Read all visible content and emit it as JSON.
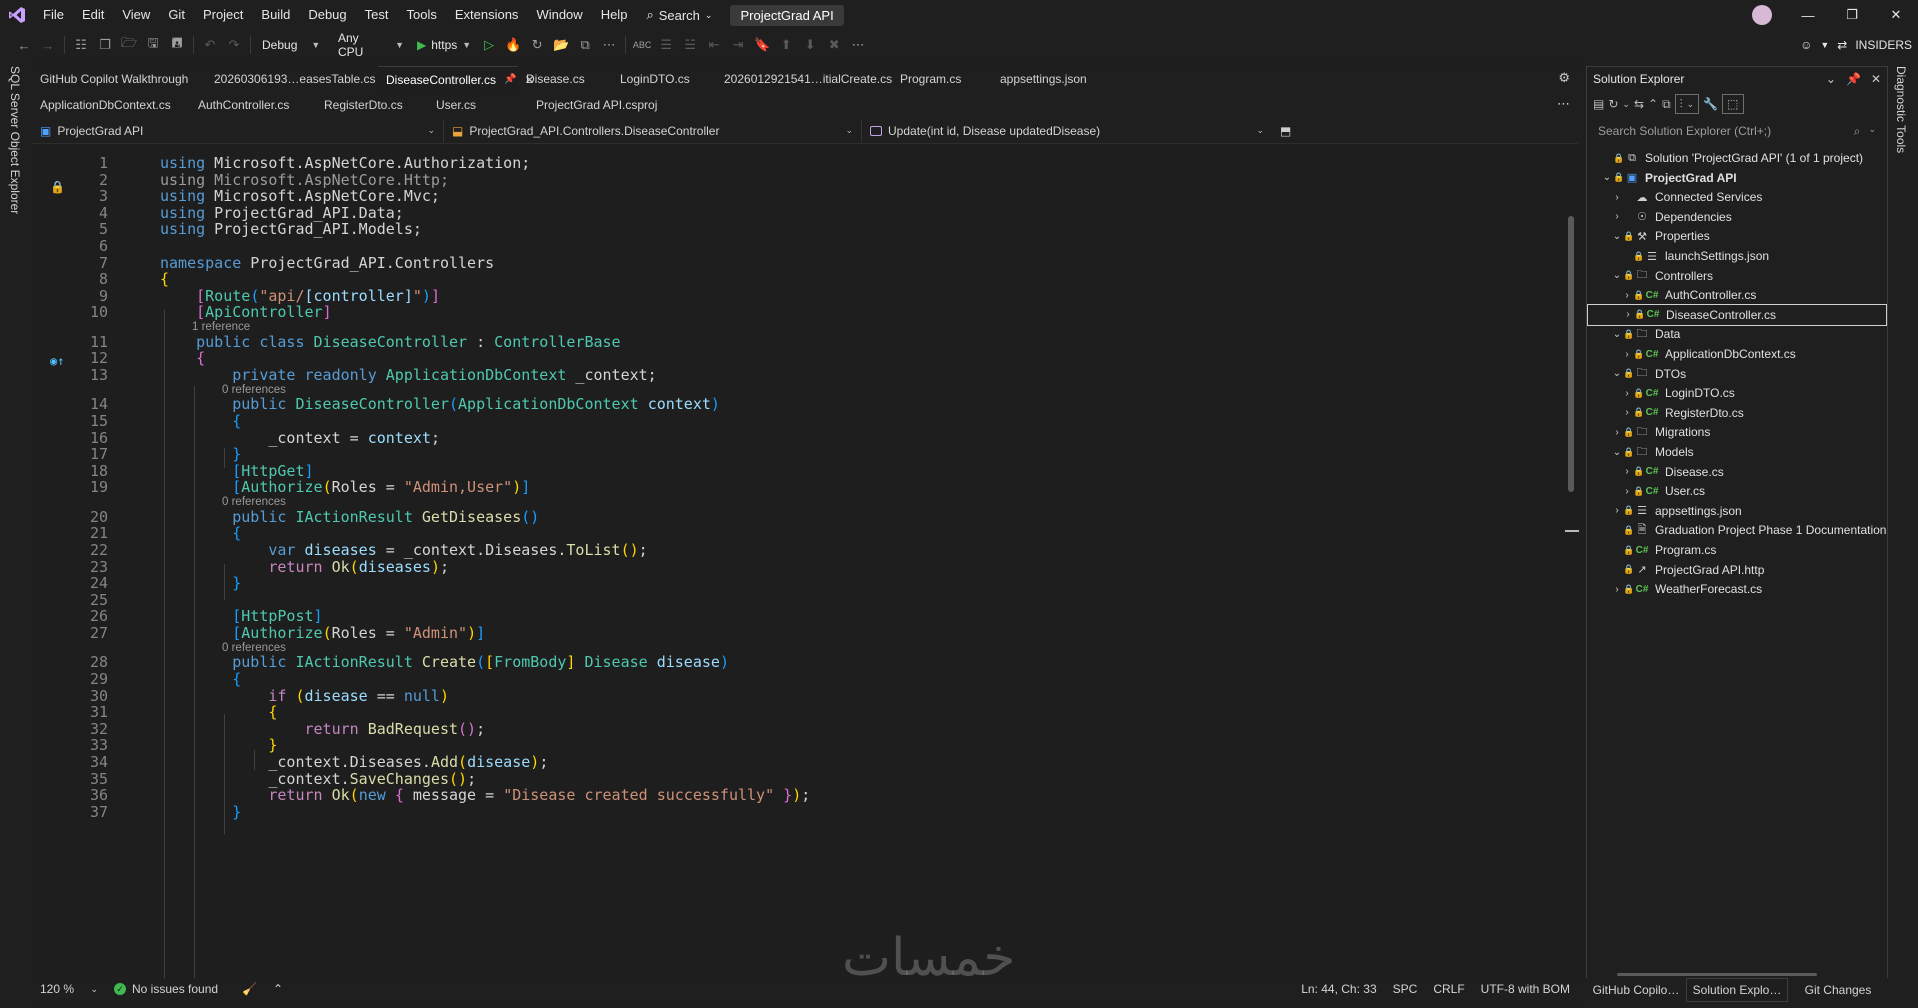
{
  "menu": {
    "items": [
      "File",
      "Edit",
      "View",
      "Git",
      "Project",
      "Build",
      "Debug",
      "Test",
      "Tools",
      "Extensions",
      "Window",
      "Help"
    ],
    "search_label": "Search",
    "project_title": "ProjectGrad API"
  },
  "toolbar": {
    "config": "Debug",
    "platform": "Any CPU",
    "run_target": "https",
    "insiders": "INSIDERS"
  },
  "left_strip": {
    "sql_label": "SQL Server Object Explorer"
  },
  "right_strip": {
    "diag_label": "Diagnostic Tools"
  },
  "tabs_row1": [
    {
      "label": "GitHub Copilot Walkthrough",
      "active": false
    },
    {
      "label": "20260306193…easesTable.cs",
      "active": false
    },
    {
      "label": "DiseaseController.cs",
      "active": true
    },
    {
      "label": "Disease.cs",
      "active": false
    },
    {
      "label": "LoginDTO.cs",
      "active": false
    },
    {
      "label": "2026012921541…itialCreate.cs",
      "active": false
    },
    {
      "label": "Program.cs",
      "active": false
    },
    {
      "label": "appsettings.json",
      "active": false
    }
  ],
  "tabs_row2": [
    {
      "label": "ApplicationDbContext.cs"
    },
    {
      "label": "AuthController.cs"
    },
    {
      "label": "RegisterDto.cs"
    },
    {
      "label": "User.cs"
    },
    {
      "label": "ProjectGrad API.csproj"
    }
  ],
  "navbar": {
    "project": "ProjectGrad API",
    "class": "ProjectGrad_API.Controllers.DiseaseController",
    "member": "Update(int id, Disease updatedDisease)"
  },
  "code_lines": [
    {
      "n": "1",
      "html": "<span class=\"kw\">using</span> Microsoft.AspNetCore.Authorization;"
    },
    {
      "n": "2",
      "html": "<span class=\"dim\">using Microsoft.AspNetCore.Http;</span>"
    },
    {
      "n": "3",
      "html": "<span class=\"kw\">using</span> Microsoft.AspNetCore.Mvc;"
    },
    {
      "n": "4",
      "html": "<span class=\"kw\">using</span> ProjectGrad_API.Data;"
    },
    {
      "n": "5",
      "html": "<span class=\"kw\">using</span> ProjectGrad_API.Models;"
    },
    {
      "n": "6",
      "html": ""
    },
    {
      "n": "7",
      "html": "<span class=\"kw\">namespace</span> ProjectGrad_API.Controllers"
    },
    {
      "n": "8",
      "html": "<span class=\"brk\">{</span>"
    },
    {
      "n": "9",
      "html": "    <span class=\"brk2\">[</span><span class=\"attr\">Route</span><span class=\"brk3\">(</span><span class=\"str\">\"api/</span><span class=\"var\">[controller]</span><span class=\"str\">\"</span><span class=\"brk3\">)</span><span class=\"brk2\">]</span>"
    },
    {
      "n": "10",
      "html": "    <span class=\"brk2\">[</span><span class=\"attr\">ApiController</span><span class=\"brk2\">]</span>"
    },
    {
      "n": "11",
      "html": "    <span class=\"kw\">public class</span> <span class=\"ty\">DiseaseController</span> : <span class=\"ty\">ControllerBase</span>"
    },
    {
      "n": "12",
      "html": "    <span class=\"brk2\">{</span>"
    },
    {
      "n": "13",
      "html": "        <span class=\"kw\">private readonly</span> <span class=\"ty\">ApplicationDbContext</span> _context;"
    },
    {
      "n": "14",
      "html": "        <span class=\"kw\">public</span> <span class=\"ty\">DiseaseController</span><span class=\"brk3\">(</span><span class=\"ty\">ApplicationDbContext</span> <span class=\"var\">context</span><span class=\"brk3\">)</span>"
    },
    {
      "n": "15",
      "html": "        <span class=\"brk3\">{</span>"
    },
    {
      "n": "16",
      "html": "            _context = <span class=\"var\">context</span>;"
    },
    {
      "n": "17",
      "html": "        <span class=\"brk3\">}</span>"
    },
    {
      "n": "18",
      "html": "        <span class=\"brk3\">[</span><span class=\"attr\">HttpGet</span><span class=\"brk3\">]</span>"
    },
    {
      "n": "19",
      "html": "        <span class=\"brk3\">[</span><span class=\"attr\">Authorize</span><span class=\"brk\">(</span>Roles = <span class=\"str\">\"Admin,User\"</span><span class=\"brk\">)</span><span class=\"brk3\">]</span>"
    },
    {
      "n": "20",
      "html": "        <span class=\"kw\">public</span> <span class=\"ty\">IActionResult</span> <span class=\"fn\">GetDiseases</span><span class=\"brk3\">()</span>"
    },
    {
      "n": "21",
      "html": "        <span class=\"brk3\">{</span>"
    },
    {
      "n": "22",
      "html": "            <span class=\"kw\">var</span> <span class=\"var\">diseases</span> = _context.Diseases.<span class=\"fn\">ToList</span><span class=\"brk\">()</span>;"
    },
    {
      "n": "23",
      "html": "            <span class=\"ctl\">return</span> <span class=\"fn\">Ok</span><span class=\"brk\">(</span><span class=\"var\">diseases</span><span class=\"brk\">)</span>;"
    },
    {
      "n": "24",
      "html": "        <span class=\"brk3\">}</span>"
    },
    {
      "n": "25",
      "html": ""
    },
    {
      "n": "26",
      "html": "        <span class=\"brk3\">[</span><span class=\"attr\">HttpPost</span><span class=\"brk3\">]</span>"
    },
    {
      "n": "27",
      "html": "        <span class=\"brk3\">[</span><span class=\"attr\">Authorize</span><span class=\"brk\">(</span>Roles = <span class=\"str\">\"Admin\"</span><span class=\"brk\">)</span><span class=\"brk3\">]</span>"
    },
    {
      "n": "28",
      "html": "        <span class=\"kw\">public</span> <span class=\"ty\">IActionResult</span> <span class=\"fn\">Create</span><span class=\"brk3\">(</span><span class=\"brk\">[</span><span class=\"attr\">FromBody</span><span class=\"brk\">]</span> <span class=\"ty\">Disease</span> <span class=\"var\">disease</span><span class=\"brk3\">)</span>"
    },
    {
      "n": "29",
      "html": "        <span class=\"brk3\">{</span>"
    },
    {
      "n": "30",
      "html": "            <span class=\"ctl\">if</span> <span class=\"brk\">(</span><span class=\"var\">disease</span> == <span class=\"kw\">null</span><span class=\"brk\">)</span>"
    },
    {
      "n": "31",
      "html": "            <span class=\"brk\">{</span>"
    },
    {
      "n": "32",
      "html": "                <span class=\"ctl\">return</span> <span class=\"fn\">BadRequest</span><span class=\"brk2\">()</span>;"
    },
    {
      "n": "33",
      "html": "            <span class=\"brk\">}</span>"
    },
    {
      "n": "34",
      "html": "            _context.Diseases.<span class=\"fn\">Add</span><span class=\"brk\">(</span><span class=\"var\">disease</span><span class=\"brk\">)</span>;"
    },
    {
      "n": "35",
      "html": "            _context.<span class=\"fn\">SaveChanges</span><span class=\"brk\">()</span>;"
    },
    {
      "n": "36",
      "html": "            <span class=\"ctl\">return</span> <span class=\"fn\">Ok</span><span class=\"brk\">(</span><span class=\"kw\">new</span> <span class=\"brk2\">{</span> message = <span class=\"str\">\"Disease created successfully\"</span> <span class=\"brk2\">}</span><span class=\"brk\">)</span>;"
    },
    {
      "n": "37",
      "html": "        <span class=\"brk3\">}</span>"
    }
  ],
  "ref_lens": [
    {
      "after": "10",
      "text": "1 reference"
    },
    {
      "after": "13",
      "text": "0 references"
    },
    {
      "after": "19",
      "text": "0 references"
    },
    {
      "after": "27",
      "text": "0 references"
    }
  ],
  "status": {
    "zoom": "120 %",
    "issues": "No issues found",
    "position": "Ln: 44, Ch: 33",
    "whitespace": "SPC",
    "line_ending": "CRLF",
    "encoding": "UTF-8 with BOM"
  },
  "solution_explorer": {
    "title": "Solution Explorer",
    "search_placeholder": "Search Solution Explorer (Ctrl+;)",
    "tree": [
      {
        "depth": 0,
        "exp": "",
        "lock": true,
        "icon": "sln",
        "label": "Solution 'ProjectGrad API' (1 of 1 project)"
      },
      {
        "depth": 0,
        "exp": "v",
        "lock": true,
        "icon": "proj",
        "label": "ProjectGrad API",
        "bold": true
      },
      {
        "depth": 1,
        "exp": ">",
        "lock": false,
        "icon": "svc",
        "label": "Connected Services"
      },
      {
        "depth": 1,
        "exp": ">",
        "lock": false,
        "icon": "dep",
        "label": "Dependencies"
      },
      {
        "depth": 1,
        "exp": "v",
        "lock": true,
        "icon": "props",
        "label": "Properties"
      },
      {
        "depth": 2,
        "exp": "",
        "lock": true,
        "icon": "json",
        "label": "launchSettings.json"
      },
      {
        "depth": 1,
        "exp": "v",
        "lock": true,
        "icon": "folder",
        "label": "Controllers"
      },
      {
        "depth": 2,
        "exp": ">",
        "lock": true,
        "icon": "cs",
        "label": "AuthController.cs"
      },
      {
        "depth": 2,
        "exp": ">",
        "lock": true,
        "icon": "cs",
        "label": "DiseaseController.cs",
        "selected": true
      },
      {
        "depth": 1,
        "exp": "v",
        "lock": true,
        "icon": "folder",
        "label": "Data"
      },
      {
        "depth": 2,
        "exp": ">",
        "lock": true,
        "icon": "cs",
        "label": "ApplicationDbContext.cs"
      },
      {
        "depth": 1,
        "exp": "v",
        "lock": true,
        "icon": "folder",
        "label": "DTOs"
      },
      {
        "depth": 2,
        "exp": ">",
        "lock": true,
        "icon": "cs",
        "label": "LoginDTO.cs"
      },
      {
        "depth": 2,
        "exp": ">",
        "lock": true,
        "icon": "cs",
        "label": "RegisterDto.cs"
      },
      {
        "depth": 1,
        "exp": ">",
        "lock": true,
        "icon": "folder",
        "label": "Migrations"
      },
      {
        "depth": 1,
        "exp": "v",
        "lock": true,
        "icon": "folder",
        "label": "Models"
      },
      {
        "depth": 2,
        "exp": ">",
        "lock": true,
        "icon": "cs",
        "label": "Disease.cs"
      },
      {
        "depth": 2,
        "exp": ">",
        "lock": true,
        "icon": "cs",
        "label": "User.cs"
      },
      {
        "depth": 1,
        "exp": ">",
        "lock": true,
        "icon": "json",
        "label": "appsettings.json"
      },
      {
        "depth": 1,
        "exp": "",
        "lock": true,
        "icon": "file",
        "label": "Graduation Project Phase 1 Documentation"
      },
      {
        "depth": 1,
        "exp": "",
        "lock": true,
        "icon": "cs",
        "label": "Program.cs"
      },
      {
        "depth": 1,
        "exp": "",
        "lock": true,
        "icon": "http",
        "label": "ProjectGrad API.http"
      },
      {
        "depth": 1,
        "exp": ">",
        "lock": true,
        "icon": "cs",
        "label": "WeatherForecast.cs"
      }
    ]
  },
  "bottom_tabs": [
    {
      "label": "GitHub Copilo…",
      "active": false
    },
    {
      "label": "Solution Explo…",
      "active": true
    },
    {
      "label": "Git Changes",
      "active": false
    }
  ],
  "watermark": "خمسات",
  "colors": {
    "accent": "#569cd6",
    "type": "#4ec9b0",
    "string": "#ce9178",
    "ok": "#3fb950"
  }
}
